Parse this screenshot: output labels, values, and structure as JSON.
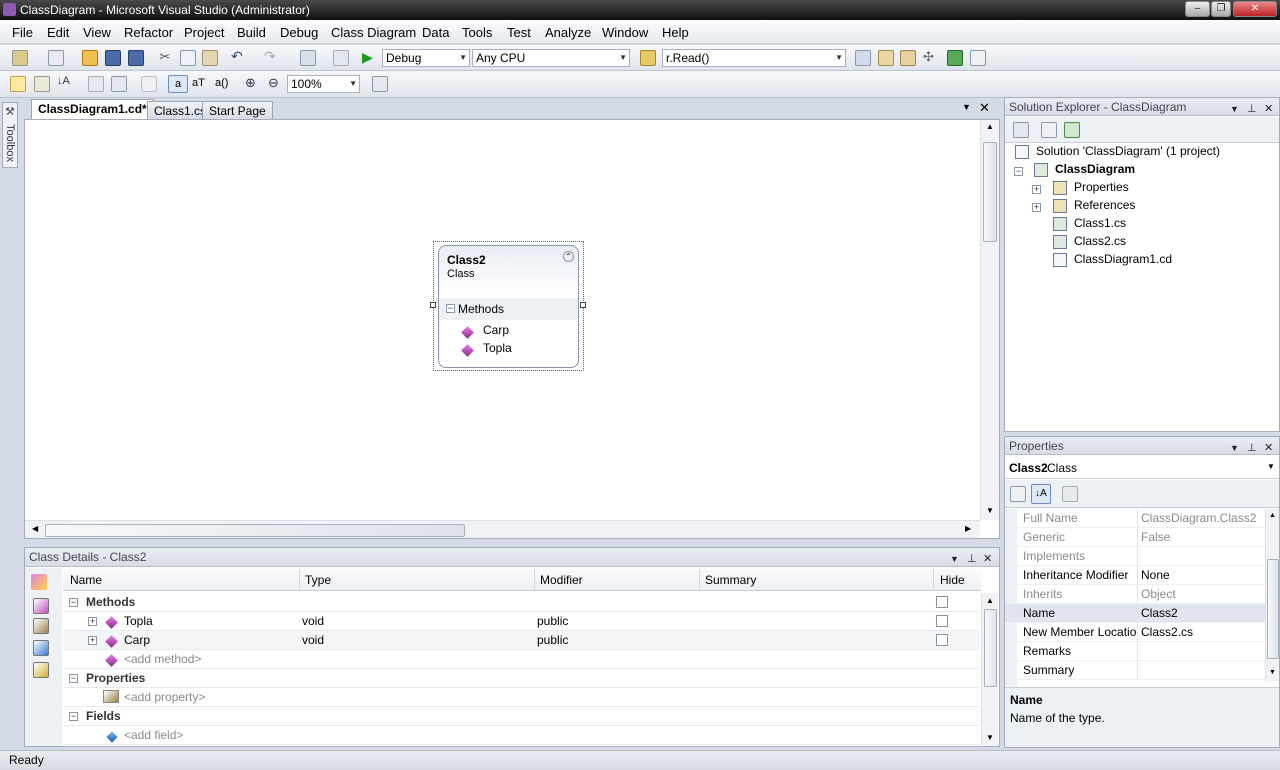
{
  "window": {
    "title": "ClassDiagram - Microsoft Visual Studio (Administrator)"
  },
  "menu": [
    "File",
    "Edit",
    "View",
    "Refactor",
    "Project",
    "Build",
    "Debug",
    "Class Diagram",
    "Data",
    "Tools",
    "Test",
    "Analyze",
    "Window",
    "Help"
  ],
  "toolbar": {
    "config": "Debug",
    "platform": "Any CPU",
    "find": "r.Read()",
    "zoom": "100%",
    "toggle_a": "a",
    "toggle_aT": "aT",
    "toggle_a0": "a()"
  },
  "toolbox": {
    "label": "Toolbox"
  },
  "tabs": [
    "ClassDiagram1.cd*",
    "Class1.cs",
    "Start Page"
  ],
  "diagram": {
    "class_name": "Class2",
    "class_kind": "Class",
    "section": "Methods",
    "methods": [
      "Carp",
      "Topla"
    ]
  },
  "class_details": {
    "title": "Class Details - Class2",
    "headers": {
      "name": "Name",
      "type": "Type",
      "modifier": "Modifier",
      "summary": "Summary",
      "hide": "Hide"
    },
    "methods_group": "Methods",
    "rows": [
      {
        "name": "Topla",
        "type": "void",
        "modifier": "public"
      },
      {
        "name": "Carp",
        "type": "void",
        "modifier": "public"
      }
    ],
    "add_method": "<add method>",
    "properties_group": "Properties",
    "add_property": "<add property>",
    "fields_group": "Fields",
    "add_field": "<add field>"
  },
  "solution_explorer": {
    "title": "Solution Explorer - ClassDiagram",
    "solution": "Solution 'ClassDiagram' (1 project)",
    "project": "ClassDiagram",
    "items": [
      "Properties",
      "References",
      "Class1.cs",
      "Class2.cs",
      "ClassDiagram1.cd"
    ]
  },
  "properties": {
    "title": "Properties",
    "object_name": "Class2",
    "object_type": "Class",
    "rows": [
      {
        "key": "Full Name",
        "value": "ClassDiagram.Class2",
        "dim": true
      },
      {
        "key": "Generic",
        "value": "False",
        "dim": true
      },
      {
        "key": "Implements",
        "value": "",
        "dim": true
      },
      {
        "key": "Inheritance Modifier",
        "value": "None",
        "dim": false
      },
      {
        "key": "Inherits",
        "value": "Object",
        "dim": true
      },
      {
        "key": "Name",
        "value": "Class2",
        "dim": false
      },
      {
        "key": "New Member Locatio",
        "value": "Class2.cs",
        "dim": false
      },
      {
        "key": "Remarks",
        "value": "",
        "dim": false
      },
      {
        "key": "Summary",
        "value": "",
        "dim": false
      }
    ],
    "desc_title": "Name",
    "desc_text": "Name of the type."
  },
  "status": {
    "text": "Ready"
  }
}
